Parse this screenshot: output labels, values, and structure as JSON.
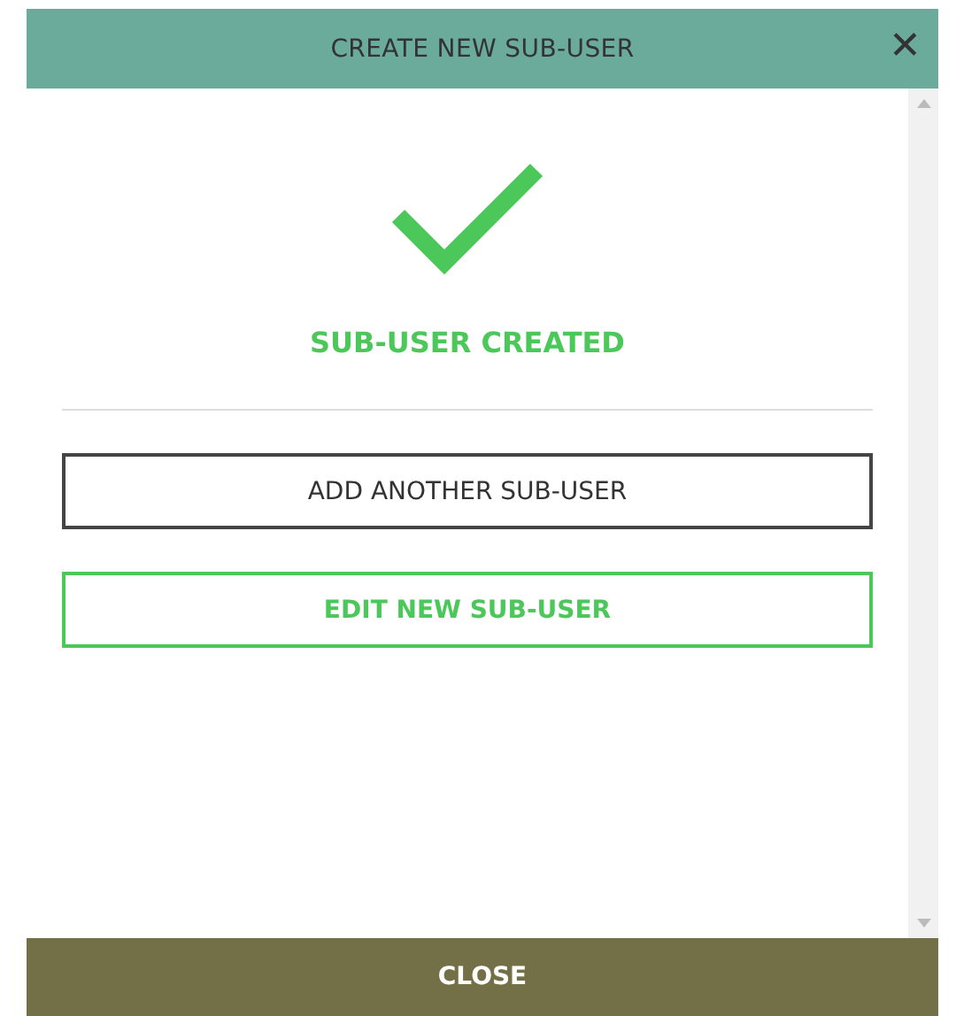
{
  "dialog": {
    "title": "CREATE NEW SUB-USER",
    "close_glyph": "✕"
  },
  "status": {
    "message": "SUB-USER CREATED"
  },
  "actions": [
    {
      "label": "ADD ANOTHER SUB-USER",
      "kind": "secondary"
    },
    {
      "label": "EDIT NEW SUB-USER",
      "kind": "primary"
    }
  ],
  "footer": {
    "label": "CLOSE"
  }
}
